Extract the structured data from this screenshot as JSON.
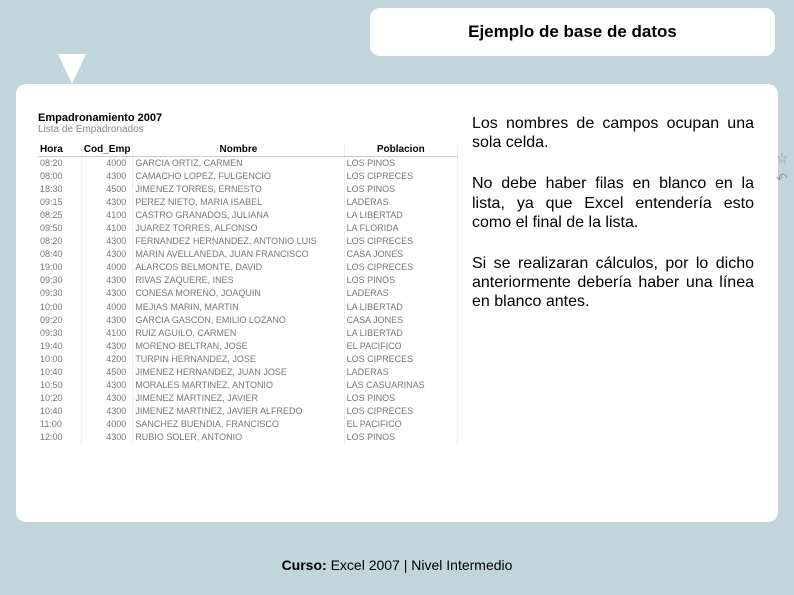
{
  "header": {
    "title": "Ejemplo de base de datos"
  },
  "sheet": {
    "title": "Empadronamiento 2007",
    "subtitle": "Lista de Empadronados",
    "columns": [
      "Hora",
      "Cod_Emp",
      "Nombre",
      "Poblacion"
    ],
    "rows": [
      [
        "08:20",
        "4000",
        "GARCIA ORTIZ, CARMEN",
        "LOS PINOS"
      ],
      [
        "08:00",
        "4300",
        "CAMACHO LOPEZ, FULGENCIO",
        "LOS CIPRECES"
      ],
      [
        "18:30",
        "4500",
        "JIMENEZ TORRES, ERNESTO",
        "LOS PINOS"
      ],
      [
        "09:15",
        "4300",
        "PEREZ NIETO, MARIA ISABEL",
        "LADERAS"
      ],
      [
        "08:25",
        "4100",
        "CASTRO GRANADOS, JULIANA",
        "LA LIBERTAD"
      ],
      [
        "09:50",
        "4100",
        "JUAREZ TORRES, ALFONSO",
        "LA FLORIDA"
      ],
      [
        "08:20",
        "4300",
        "FERNANDEZ HERNANDEZ, ANTONIO LUIS",
        "LOS CIPRECES"
      ],
      [
        "08:40",
        "4300",
        "MARIN AVELLANEDA, JUAN FRANCISCO",
        "CASA JONES"
      ],
      [
        "19:00",
        "4000",
        "ALARCOS BELMONTE, DAVID",
        "LOS CIPRECES"
      ],
      [
        "09:30",
        "4300",
        "RIVAS ZAQUERE, INES",
        "LOS PINOS"
      ],
      [
        "09:30",
        "4300",
        "CONESA MORENO, JOAQUIN",
        "LADERAS"
      ],
      [
        "10:00",
        "4000",
        "MEJIAS MARIN, MARTIN",
        "LA LIBERTAD"
      ],
      [
        "09:20",
        "4300",
        "GARCIA GASCON, EMILIO LOZANO",
        "CASA JONES"
      ],
      [
        "09:30",
        "4100",
        "RUIZ AGUILO, CARMEN",
        "LA LIBERTAD"
      ],
      [
        "19:40",
        "4300",
        "MORENO BELTRAN, JOSE",
        "EL PACIFICO"
      ],
      [
        "10:00",
        "4200",
        "TURPIN HERNANDEZ, JOSE",
        "LOS CIPRECES"
      ],
      [
        "10:40",
        "4500",
        "JIMENEZ HERNANDEZ, JUAN JOSE",
        "LADERAS"
      ],
      [
        "10:50",
        "4300",
        "MORALES MARTINEZ, ANTONIO",
        "LAS CASUARINAS"
      ],
      [
        "10:20",
        "4300",
        "JIMENEZ MARTINEZ, JAVIER",
        "LOS PINOS"
      ],
      [
        "10:40",
        "4300",
        "JIMENEZ MARTINEZ, JAVIER ALFREDO",
        "LOS CIPRECES"
      ],
      [
        "11:00",
        "4000",
        "SANCHEZ BUENDIA, FRANCISCO",
        "EL PACIFICO"
      ],
      [
        "12:00",
        "4300",
        "RUBIO SOLER, ANTONIO",
        "LOS PINOS"
      ]
    ]
  },
  "explain": {
    "p1": "Los nombres de campos ocupan una sola celda.",
    "p2": "No debe haber filas en blanco en la lista, ya que Excel entendería esto como el final de la lista.",
    "p3": "Si se realizaran cálculos, por lo dicho anteriormente debería haber una línea en blanco antes."
  },
  "icons": {
    "star": "☆",
    "undo": "↶"
  },
  "footer": {
    "label": "Curso:",
    "text": " Excel 2007 | Nivel Intermedio"
  }
}
